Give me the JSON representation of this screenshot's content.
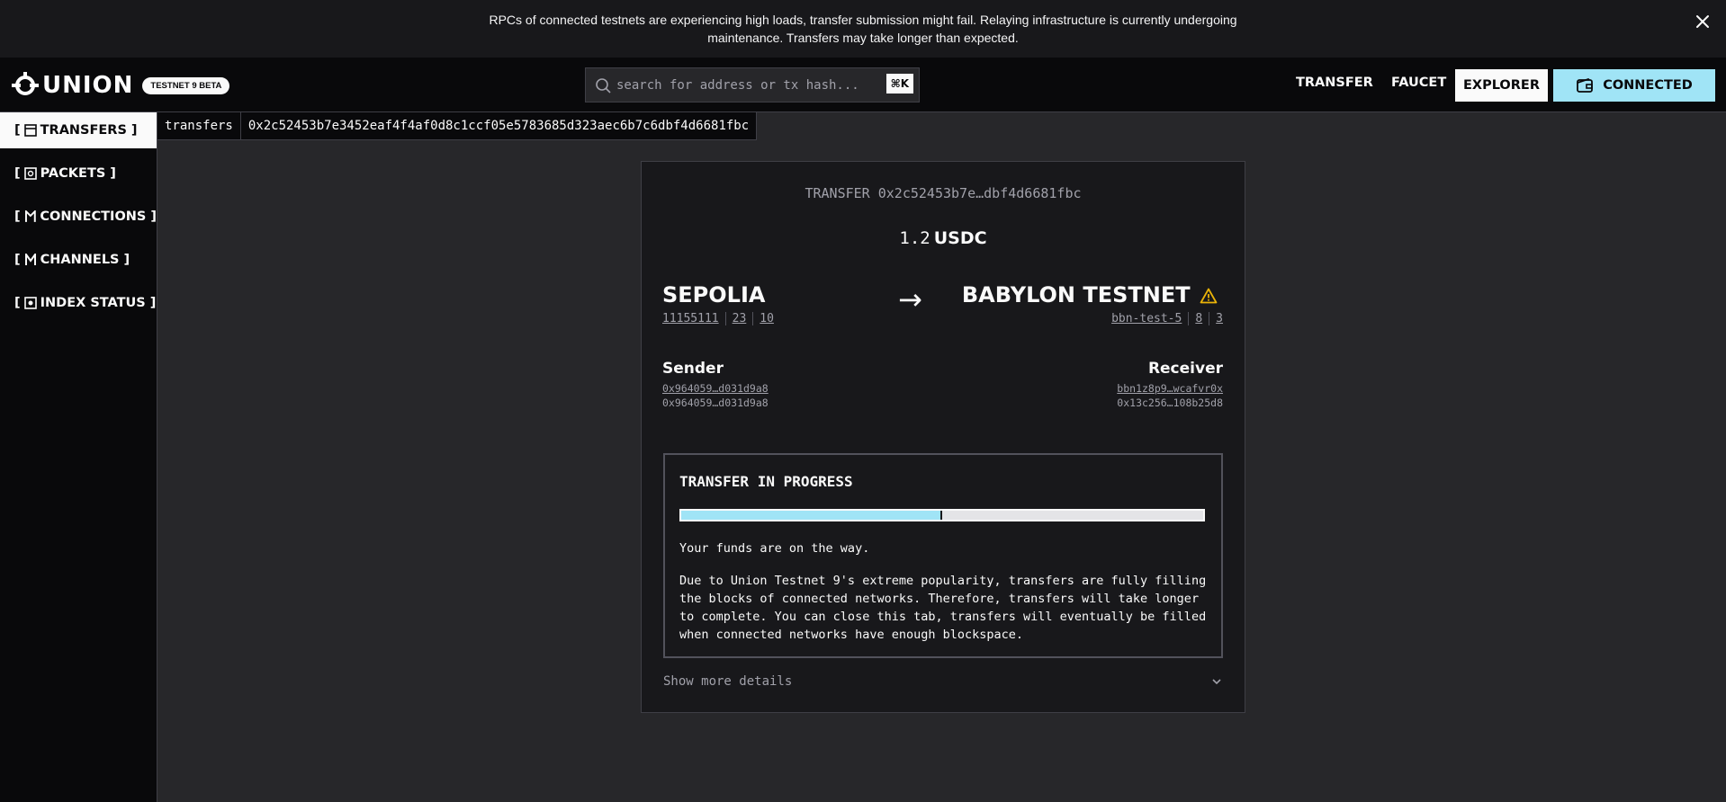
{
  "banner": {
    "message": "RPCs of connected testnets are experiencing high loads, transfer submission might fail. Relaying infrastructure is currently undergoing maintenance. Transfers may take longer than expected."
  },
  "header": {
    "logo_text": "UNION",
    "badge": "TESTNET 9 BETA",
    "search": {
      "placeholder": "search for address or tx hash...",
      "shortcut": "⌘K"
    },
    "nav": {
      "transfer": "TRANSFER",
      "faucet": "FAUCET",
      "explorer": "EXPLORER",
      "connected": "CONNECTED"
    }
  },
  "sidebar": {
    "items": [
      {
        "label": "TRANSFERS",
        "icon": "table-icon"
      },
      {
        "label": "PACKETS",
        "icon": "packet-icon"
      },
      {
        "label": "CONNECTIONS",
        "icon": "connection-icon"
      },
      {
        "label": "CHANNELS",
        "icon": "channel-icon"
      },
      {
        "label": "INDEX STATUS",
        "icon": "index-icon"
      }
    ]
  },
  "breadcrumb": {
    "section": "transfers",
    "hash": "0x2c52453b7e3452eaf4f4af0d8c1ccf05e5783685d323aec6b7c6dbf4d6681fbc"
  },
  "transfer": {
    "title": "TRANSFER 0x2c52453b7e…dbf4d6681fbc",
    "amount": "1.2",
    "denom": "USDC",
    "source": {
      "name": "SEPOLIA",
      "chain_id": "11155111",
      "connection": "23",
      "channel": "10"
    },
    "destination": {
      "name": "BABYLON TESTNET",
      "chain_id": "bbn-test-5",
      "connection": "8",
      "channel": "3"
    },
    "sender": {
      "label": "Sender",
      "address": "0x964059…d031d9a8",
      "raw": "0x964059…d031d9a8"
    },
    "receiver": {
      "label": "Receiver",
      "address": "bbn1z8p9…wcafvr0x",
      "raw": "0x13c256…108b25d8"
    },
    "progress": {
      "title": "TRANSFER IN PROGRESS",
      "fraction": 0.5,
      "message": "Your funds are on the way.",
      "body": "Due to Union Testnet 9's extreme popularity, transfers are fully filling the blocks of connected networks. Therefore, transfers will take longer to complete. You can close this tab, transfers will eventually be filled when connected networks have enough blockspace."
    },
    "details_toggle": "Show more details"
  },
  "colors": {
    "accent": "#a0e4f6",
    "warning": "#eab308",
    "background": "#27272a",
    "panel": "#09090b"
  }
}
